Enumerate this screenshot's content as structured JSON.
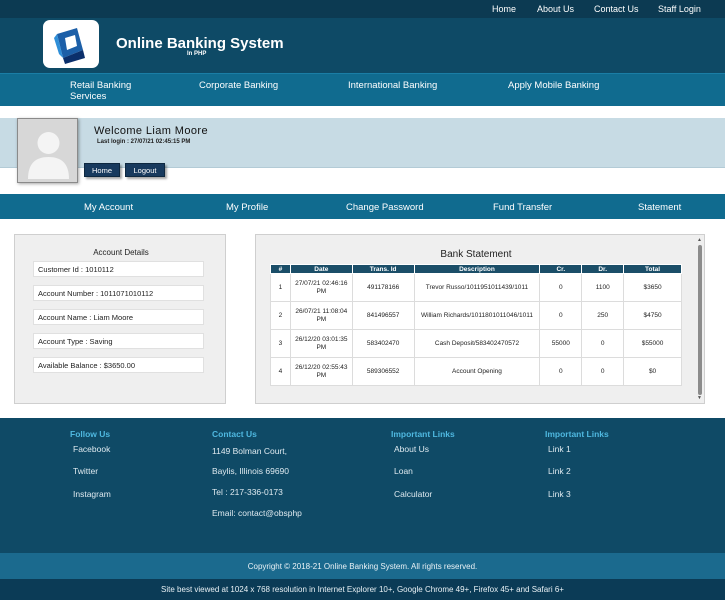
{
  "topnav": [
    "Home",
    "About Us",
    "Contact Us",
    "Staff Login"
  ],
  "brand": {
    "title": "Online Banking System",
    "subtitle": "In PHP"
  },
  "mainnav": [
    "Retail Banking Services",
    "Corporate Banking",
    "International Banking",
    "Apply Mobile Banking"
  ],
  "welcome": {
    "greeting": "Welcome  Liam  Moore",
    "last_login": "Last login : 27/07/21 02:45:15 PM",
    "home_btn": "Home",
    "logout_btn": "Logout"
  },
  "subnav": [
    "My Account",
    "My Profile",
    "Change Password",
    "Fund Transfer",
    "Statement"
  ],
  "account_details": {
    "title": "Account Details",
    "fields": [
      "Customer Id : 1010112",
      "Account Number : 1011071010112",
      "Account Name : Liam Moore",
      "Account Type : Saving",
      "Available Balance : $3650.00"
    ]
  },
  "statement": {
    "title": "Bank Statement",
    "headers": [
      "#",
      "Date",
      "Trans. Id",
      "Description",
      "Cr.",
      "Dr.",
      "Total"
    ],
    "rows": [
      [
        "1",
        "27/07/21 02:46:16 PM",
        "491178166",
        "Trevor Russo/1011951011439/1011",
        "0",
        "1100",
        "$3650"
      ],
      [
        "2",
        "26/07/21 11:08:04 PM",
        "841496557",
        "William Richards/1011801011046/1011",
        "0",
        "250",
        "$4750"
      ],
      [
        "3",
        "26/12/20 03:01:35 PM",
        "583402470",
        "Cash Deposit/583402470572",
        "55000",
        "0",
        "$55000"
      ],
      [
        "4",
        "26/12/20 02:55:43 PM",
        "589306552",
        "Account Opening",
        "0",
        "0",
        "$0"
      ]
    ]
  },
  "footer": {
    "follow_title": "Follow Us",
    "follow_links": [
      "Facebook",
      "Twitter",
      "Instagram"
    ],
    "contact_title": "Contact Us",
    "contact_lines": [
      "1149 Bolman Court,",
      "Baylis, Illinois 69690",
      "Tel : 217-336-0173",
      "Email: contact@obsphp"
    ],
    "links1_title": "Important Links",
    "links1": [
      "About Us",
      "Loan",
      "Calculator"
    ],
    "links2_title": "Important Links",
    "links2": [
      "Link 1",
      "Link 2",
      "Link 3"
    ]
  },
  "copyright": "Copyright © 2018-21 Online Banking System. All rights reserved.",
  "best_viewed": "Site best viewed at 1024 x 768 resolution in Internet Explorer 10+, Google Chrome 49+, Firefox 45+ and Safari 6+",
  "colors": {
    "dark_navy": "#0c3a52",
    "header": "#0e4a66",
    "nav": "#106b8f",
    "accent_link": "#4fb8e0",
    "welcome_band": "#c7dbe4"
  }
}
